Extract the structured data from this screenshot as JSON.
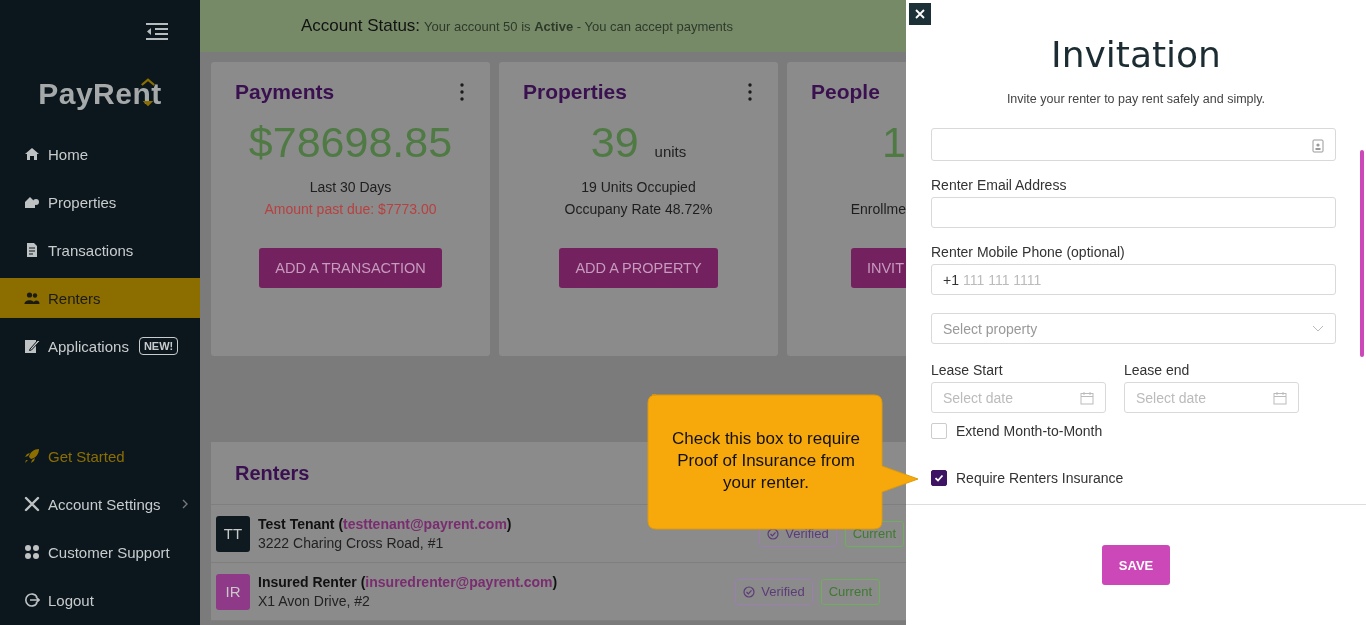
{
  "sidebar": {
    "logo": "PayRent",
    "top_items": [
      {
        "label": "Home",
        "selected": false,
        "highlight": false,
        "submenu": false
      },
      {
        "label": "Properties",
        "selected": false,
        "highlight": false,
        "submenu": false
      },
      {
        "label": "Transactions",
        "selected": false,
        "highlight": false,
        "submenu": false
      },
      {
        "label": "Renters",
        "selected": true,
        "highlight": false,
        "submenu": false
      },
      {
        "label": "Applications",
        "selected": false,
        "highlight": false,
        "submenu": false,
        "badge": "NEW!"
      }
    ],
    "bottom_items": [
      {
        "label": "Get Started",
        "selected": false,
        "highlight": true,
        "submenu": false
      },
      {
        "label": "Account Settings",
        "selected": false,
        "highlight": false,
        "submenu": true
      },
      {
        "label": "Customer Support",
        "selected": false,
        "highlight": false,
        "submenu": false
      },
      {
        "label": "Logout",
        "selected": false,
        "highlight": false,
        "submenu": false
      }
    ]
  },
  "account_status": {
    "label": "Account Status:",
    "message": "Your account 50 is **Active** - You can accept payments"
  },
  "cards": [
    {
      "title": "Payments",
      "menu": true,
      "value": "$78698.85",
      "lines": [
        {
          "text": "Last 30 Days",
          "kind": "normal"
        },
        {
          "text": "Amount past due: $7773.00",
          "kind": "alert"
        }
      ],
      "button": "ADD A TRANSACTION"
    },
    {
      "title": "Properties",
      "menu": true,
      "value": "39",
      "unit": "units",
      "lines": [
        {
          "text": "19 Units Occupied",
          "kind": "normal"
        },
        {
          "text": "Occupany Rate 48.72%",
          "kind": "normal"
        }
      ],
      "button": "ADD A PROPERTY"
    },
    {
      "title": "People",
      "menu": false,
      "value": "1",
      "lines": [
        {
          "kind": "spacer"
        },
        {
          "text": "Enrollme",
          "kind": "normal"
        }
      ],
      "button": "INVIT"
    }
  ],
  "renters": {
    "title": "Renters",
    "rows": [
      {
        "initials": "TT",
        "color": "#0e1a1f",
        "name": "Test Tenant (",
        "email": "testtenant@payrent.com",
        "name_end": ")",
        "address": "3222 Charing Cross Road, #1",
        "badges": [
          {
            "label": "Verified",
            "kind": "verified"
          },
          {
            "label": "Current",
            "kind": "current"
          }
        ]
      },
      {
        "initials": "IR",
        "color": "#8e3a88",
        "name": "Insured Renter (",
        "email": "insuredrenter@payrent.com",
        "name_end": ")",
        "address": "X1 Avon Drive, #2",
        "badges": [
          {
            "label": "Verified",
            "kind": "verified"
          },
          {
            "label": "Current",
            "kind": "current"
          }
        ]
      }
    ]
  },
  "invitation": {
    "title": "Invitation",
    "subtitle": "Invite your renter to pay rent safely and simply.",
    "fields": [
      {
        "kind": "clipped"
      },
      {
        "kind": "text",
        "label": "Renter Email Address"
      },
      {
        "kind": "phone",
        "label": "Renter Mobile Phone (optional)",
        "prefix": "+1",
        "placeholder": "111 111 1111"
      },
      {
        "kind": "select",
        "placeholder": "Select property"
      },
      {
        "kind": "dates",
        "dates": [
          {
            "label": "Lease Start",
            "placeholder": "Select date"
          },
          {
            "label": "Lease end",
            "placeholder": "Select date"
          }
        ]
      },
      {
        "kind": "checkbox",
        "label": "Extend Month-to-Month",
        "checked": false
      },
      {
        "kind": "checkbox",
        "label": "Require Renters Insurance",
        "checked": true
      }
    ],
    "save": "SAVE"
  },
  "callout": {
    "text": "Check this box to require Proof of Insurance from your renter."
  }
}
